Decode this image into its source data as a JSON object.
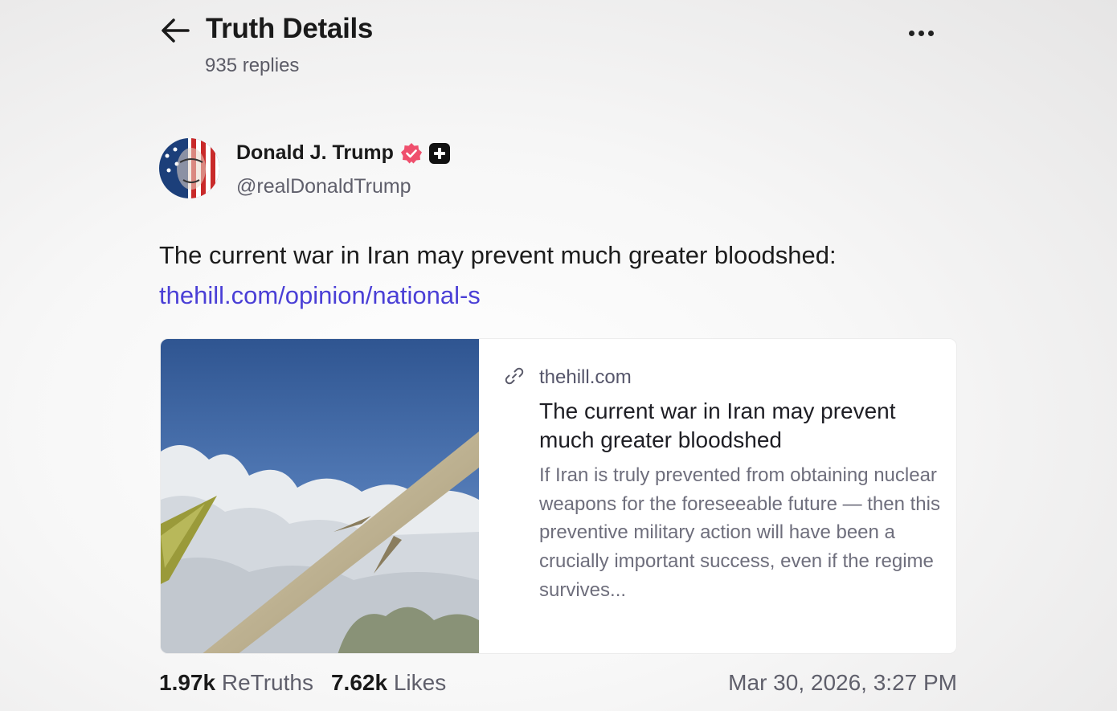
{
  "header": {
    "title": "Truth Details",
    "replies": "935 replies"
  },
  "author": {
    "name": "Donald J. Trump",
    "handle": "@realDonaldTrump"
  },
  "post": {
    "text": "The current war in Iran may prevent much greater bloodshed:",
    "link": "thehill.com/opinion/national-s"
  },
  "card": {
    "domain": "thehill.com",
    "title": "The current war in Iran may prevent much greater bloodshed",
    "description": "If Iran is truly prevented from obtaining nuclear weapons for the foreseeable future — then this preventive military action will have been a crucially important success, even if the regime survives..."
  },
  "stats": {
    "retruths_count": "1.97k",
    "retruths_label": "ReTruths",
    "likes_count": "7.62k",
    "likes_label": "Likes",
    "timestamp": "Mar 30, 2026, 3:27 PM"
  },
  "colors": {
    "link": "#4a3fd6",
    "verified_badge": "#ef4f6d"
  }
}
